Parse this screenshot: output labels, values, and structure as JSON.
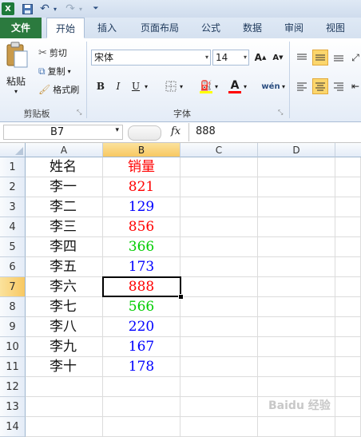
{
  "quick_access": {
    "app_icon": "excel-logo-icon",
    "items": [
      "save-icon",
      "undo-icon",
      "redo-icon",
      "customize-icon"
    ]
  },
  "tabs": [
    "文件",
    "开始",
    "插入",
    "页面布局",
    "公式",
    "数据",
    "审阅",
    "视图"
  ],
  "active_tab": "开始",
  "clipboard": {
    "paste": "粘贴",
    "cut": "剪切",
    "copy": "复制",
    "format_painter": "格式刷",
    "group_label": "剪贴板"
  },
  "font": {
    "name": "宋体",
    "size": "14",
    "group_label": "字体",
    "bold": "B",
    "italic": "I",
    "underline": "U",
    "phonetic": "wén",
    "font_color": "#ff0000",
    "fill_color": "#ffff00"
  },
  "formula_bar": {
    "name_box": "B7",
    "fx": "fx",
    "value": "888"
  },
  "columns": [
    "A",
    "B",
    "C",
    "D"
  ],
  "selected_column": "B",
  "rows": [
    "1",
    "2",
    "3",
    "4",
    "5",
    "6",
    "7",
    "8",
    "9",
    "10",
    "11",
    "12",
    "13",
    "14"
  ],
  "selected_row": "7",
  "cells": [
    {
      "a": "姓名",
      "b": "销量",
      "b_color": "#ff0000"
    },
    {
      "a": "李一",
      "b": "821",
      "b_color": "#ff0000"
    },
    {
      "a": "李二",
      "b": "129",
      "b_color": "#0000ff"
    },
    {
      "a": "李三",
      "b": "856",
      "b_color": "#ff0000"
    },
    {
      "a": "李四",
      "b": "366",
      "b_color": "#00cc00"
    },
    {
      "a": "李五",
      "b": "173",
      "b_color": "#0000ff"
    },
    {
      "a": "李六",
      "b": "888",
      "b_color": "#ff0000"
    },
    {
      "a": "李七",
      "b": "566",
      "b_color": "#00cc00"
    },
    {
      "a": "李八",
      "b": "220",
      "b_color": "#0000ff"
    },
    {
      "a": "李九",
      "b": "167",
      "b_color": "#0000ff"
    },
    {
      "a": "李十",
      "b": "178",
      "b_color": "#0000ff"
    }
  ],
  "watermark": "Baidu 经验"
}
